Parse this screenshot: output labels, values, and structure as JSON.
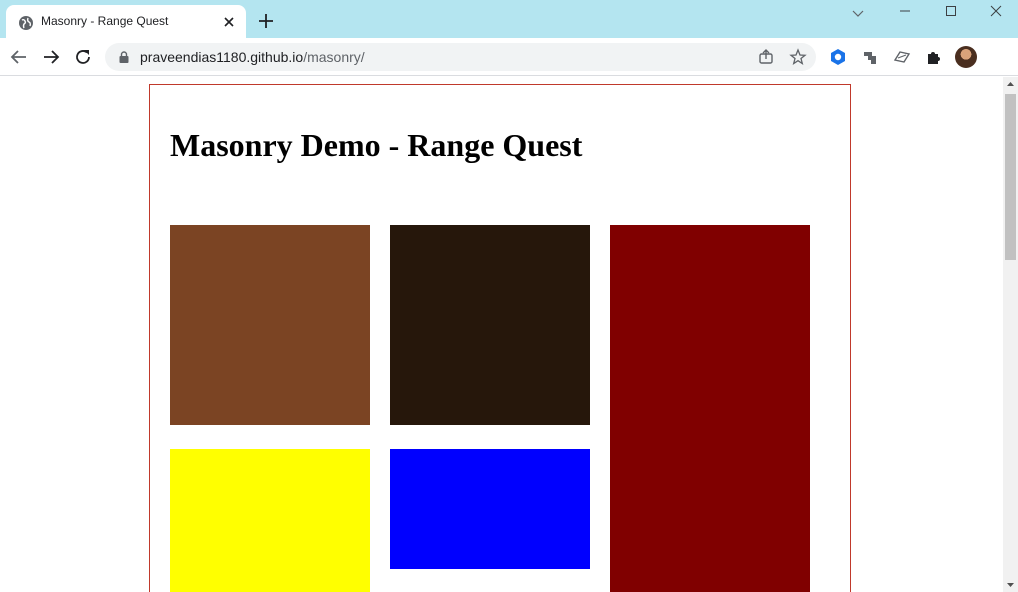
{
  "browser": {
    "tab": {
      "title": "Masonry - Range Quest"
    },
    "address": {
      "host": "praveendias1180.github.io",
      "path": "/masonry/"
    }
  },
  "page": {
    "title": "Masonry Demo - Range Quest",
    "bricks": [
      {
        "color": "#7b4423"
      },
      {
        "color": "#26170b"
      },
      {
        "color": "#800000"
      },
      {
        "color": "#ffff00"
      },
      {
        "color": "#0000ff"
      }
    ]
  },
  "colors": {
    "tab_strip": "#b4e5f0",
    "container_border": "#c0392b"
  },
  "icons": [
    "globe-icon",
    "close-icon",
    "plus-icon",
    "chevron-down-icon",
    "minimize-icon",
    "maximize-icon",
    "window-close-icon",
    "back-arrow-icon",
    "forward-arrow-icon",
    "reload-icon",
    "lock-icon",
    "share-icon",
    "star-icon",
    "extension-icon",
    "puzzle-icon",
    "kebab-menu-icon"
  ]
}
